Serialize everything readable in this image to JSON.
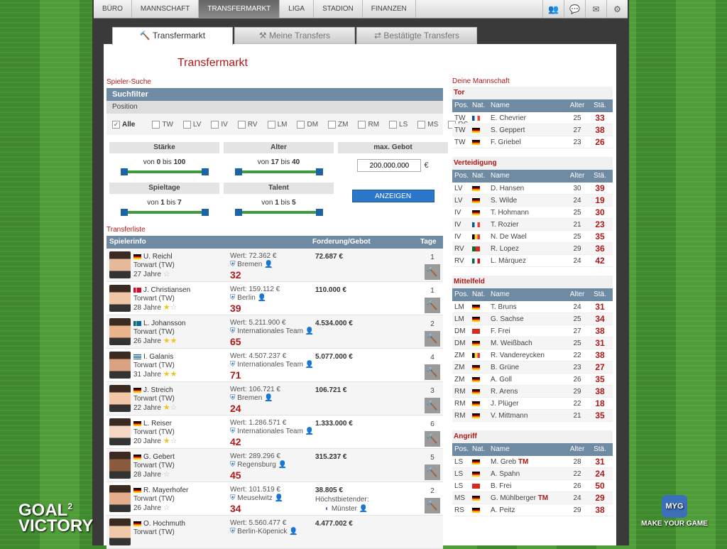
{
  "nav": {
    "items": [
      "BÜRO",
      "MANNSCHAFT",
      "TRANSFERMARKT",
      "LIGA",
      "STADION",
      "FINANZEN"
    ],
    "active": 2,
    "icons": [
      "people-icon",
      "chat-icon",
      "mail-icon",
      "settings-icon"
    ]
  },
  "tabs": [
    "Transfermarkt",
    "Meine Transfers",
    "Bestätigte Transfers"
  ],
  "title": "Transfermarkt",
  "search": {
    "section": "Spieler-Suche",
    "filter": "Suchfilter",
    "position_label": "Position",
    "positions": [
      "Alle",
      "TW",
      "LV",
      "IV",
      "RV",
      "LM",
      "DM",
      "ZM",
      "RM",
      "LS",
      "MS",
      "RS"
    ],
    "staerke_label": "Stärke",
    "staerke": {
      "von": "0",
      "bis": "100"
    },
    "alter_label": "Alter",
    "alter": {
      "von": "17",
      "bis": "40"
    },
    "gebot_label": "max. Gebot",
    "gebot_value": "200.000.000",
    "currency": "€",
    "spieltage_label": "Spieltage",
    "spieltage": {
      "von": "1",
      "bis": "7"
    },
    "talent_label": "Talent",
    "talent": {
      "von": "1",
      "bis": "5"
    },
    "von": "von",
    "bis": "bis",
    "show_button": "ANZEIGEN"
  },
  "list": {
    "section": "Transferliste",
    "col_info": "Spielerinfo",
    "col_forderung": "Forderung/Gebot",
    "col_tage": "Tage",
    "players": [
      {
        "name": "U. Reichl",
        "pos": "Torwart (TW)",
        "age": "27 Jahre",
        "stars": 0,
        "flag": "de",
        "wert": "Wert: 72.362 €",
        "club": "Bremen",
        "staerke": "32",
        "forderung": "72.687 €",
        "tage": "1"
      },
      {
        "name": "J. Christiansen",
        "pos": "Torwart (TW)",
        "age": "28 Jahre",
        "stars": 1,
        "flag": "dk",
        "wert": "Wert: 159.112 €",
        "club": "Berlin",
        "staerke": "39",
        "forderung": "110.000 €",
        "tage": "1"
      },
      {
        "name": "L. Johansson",
        "pos": "Torwart (TW)",
        "age": "26 Jahre",
        "stars": 2,
        "flag": "se",
        "wert": "Wert: 5.211.900 €",
        "club": "Internationales Team",
        "staerke": "65",
        "forderung": "4.534.000 €",
        "tage": "2"
      },
      {
        "name": "I. Galanis",
        "pos": "Torwart (TW)",
        "age": "31 Jahre",
        "stars": 2,
        "flag": "gr",
        "wert": "Wert: 4.507.237 €",
        "club": "Internationales Team",
        "staerke": "71",
        "forderung": "5.077.000 €",
        "tage": "4"
      },
      {
        "name": "J. Streich",
        "pos": "Torwart (TW)",
        "age": "22 Jahre",
        "stars": 1,
        "flag": "de",
        "wert": "Wert: 106.721 €",
        "club": "Bremen",
        "staerke": "24",
        "forderung": "106.721 €",
        "tage": "3"
      },
      {
        "name": "L. Reiser",
        "pos": "Torwart (TW)",
        "age": "20 Jahre",
        "stars": 1,
        "flag": "de",
        "wert": "Wert: 1.286.571 €",
        "club": "Internationales Team",
        "staerke": "42",
        "forderung": "1.333.000 €",
        "tage": "6"
      },
      {
        "name": "G. Gebert",
        "pos": "Torwart (TW)",
        "age": "28 Jahre",
        "stars": 0,
        "flag": "de",
        "wert": "Wert: 289.296 €",
        "club": "Regensburg",
        "staerke": "45",
        "forderung": "315.237 €",
        "tage": "5"
      },
      {
        "name": "R. Mayerhofer",
        "pos": "Torwart (TW)",
        "age": "26 Jahre",
        "stars": 0,
        "flag": "de",
        "wert": "Wert: 101.519 €",
        "club": "Meuselwitz",
        "staerke": "34",
        "forderung": "38.805 €",
        "bidder_label": "Höchstbietender:",
        "bidder": "Münster",
        "tage": "2"
      },
      {
        "name": "O. Hochmuth",
        "pos": "Torwart (TW)",
        "age": "",
        "stars": 0,
        "flag": "de",
        "wert": "Wert: 5.560.477 €",
        "club": "Berlin-Köpenick",
        "staerke": "",
        "forderung": "4.477.002 €",
        "tage": ""
      }
    ]
  },
  "team": {
    "section": "Deine Mannschaft",
    "cols": [
      "Pos.",
      "Nat.",
      "Name",
      "Alter",
      "Stä."
    ],
    "groups": [
      {
        "name": "Tor",
        "rows": [
          [
            "TW",
            "fr",
            "E. Chevrier",
            "25",
            "33"
          ],
          [
            "TW",
            "de",
            "S. Geppert",
            "27",
            "38"
          ],
          [
            "TW",
            "de",
            "F. Griebel",
            "23",
            "26"
          ]
        ]
      },
      {
        "name": "Verteidigung",
        "rows": [
          [
            "LV",
            "de",
            "D. Hansen",
            "30",
            "39"
          ],
          [
            "LV",
            "de",
            "S. Wilde",
            "24",
            "19"
          ],
          [
            "IV",
            "de",
            "T. Hohmann",
            "25",
            "30"
          ],
          [
            "IV",
            "fr",
            "T. Rozier",
            "21",
            "23"
          ],
          [
            "IV",
            "be",
            "N. De Wael",
            "25",
            "35"
          ],
          [
            "RV",
            "pt",
            "R. Lopez",
            "29",
            "36"
          ],
          [
            "RV",
            "mx",
            "L. Márquez",
            "24",
            "42"
          ]
        ]
      },
      {
        "name": "Mittelfeld",
        "rows": [
          [
            "LM",
            "de",
            "T. Bruns",
            "24",
            "31"
          ],
          [
            "LM",
            "de",
            "G. Sachse",
            "25",
            "34"
          ],
          [
            "DM",
            "ch",
            "F. Frei",
            "27",
            "38"
          ],
          [
            "DM",
            "de",
            "M. Weißbach",
            "25",
            "31"
          ],
          [
            "ZM",
            "be",
            "R. Vandereycken",
            "22",
            "38"
          ],
          [
            "ZM",
            "de",
            "B. Grüne",
            "23",
            "27"
          ],
          [
            "ZM",
            "de",
            "A. Goll",
            "26",
            "35"
          ],
          [
            "RM",
            "de",
            "R. Arens",
            "29",
            "38"
          ],
          [
            "RM",
            "de",
            "J. Plüger",
            "22",
            "18"
          ],
          [
            "RM",
            "de",
            "V. Mittmann",
            "21",
            "35"
          ]
        ]
      },
      {
        "name": "Angriff",
        "rows": [
          [
            "LS",
            "de",
            "M. Greb",
            "28",
            "31",
            "TM"
          ],
          [
            "LS",
            "de",
            "A. Spahn",
            "22",
            "24"
          ],
          [
            "LS",
            "ch",
            "B. Frei",
            "26",
            "50"
          ],
          [
            "MS",
            "de",
            "G. Mühlberger",
            "24",
            "29",
            "TM"
          ],
          [
            "RS",
            "de",
            "A. Peitz",
            "29",
            "38"
          ]
        ]
      }
    ]
  },
  "logos": {
    "left": "GOAL 2 VICTORY",
    "right": "MAKE YOUR GAME",
    "right_badge": "MYG"
  }
}
